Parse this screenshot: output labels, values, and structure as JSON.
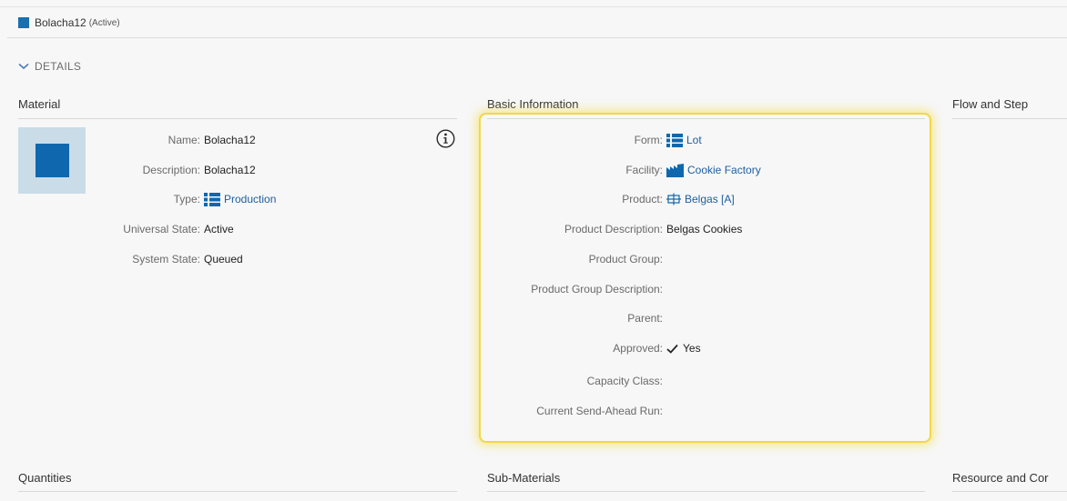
{
  "header": {
    "title": "Bolacha12",
    "state": "(Active)",
    "accent_color": "#1a6fb0"
  },
  "details_toggle": {
    "label": "DETAILS",
    "icon": "chevron-down-icon"
  },
  "sections": {
    "material": "Material",
    "basic_information": "Basic Information",
    "flow_and_step": "Flow and Step",
    "quantities": "Quantities",
    "sub_materials": "Sub-Materials",
    "resource_and_con": "Resource and Cor"
  },
  "material": {
    "name_label": "Name:",
    "name_value": "Bolacha12",
    "description_label": "Description:",
    "description_value": "Bolacha12",
    "type_label": "Type:",
    "type_value": "Production",
    "universal_state_label": "Universal State:",
    "universal_state_value": "Active",
    "system_state_label": "System State:",
    "system_state_value": "Queued"
  },
  "basic": {
    "form_label": "Form:",
    "form_value": "Lot",
    "facility_label": "Facility:",
    "facility_value": "Cookie Factory",
    "product_label": "Product:",
    "product_value": "Belgas [A]",
    "product_description_label": "Product Description:",
    "product_description_value": "Belgas Cookies",
    "product_group_label": "Product Group:",
    "product_group_description_label": "Product Group Description:",
    "parent_label": "Parent:",
    "approved_label": "Approved:",
    "approved_value": "Yes",
    "capacity_class_label": "Capacity Class:",
    "current_send_ahead_run_label": "Current Send-Ahead Run:"
  },
  "colors": {
    "link": "#1e5fa0",
    "icon_blue": "#0f68ad",
    "highlight": "#f3d743"
  }
}
